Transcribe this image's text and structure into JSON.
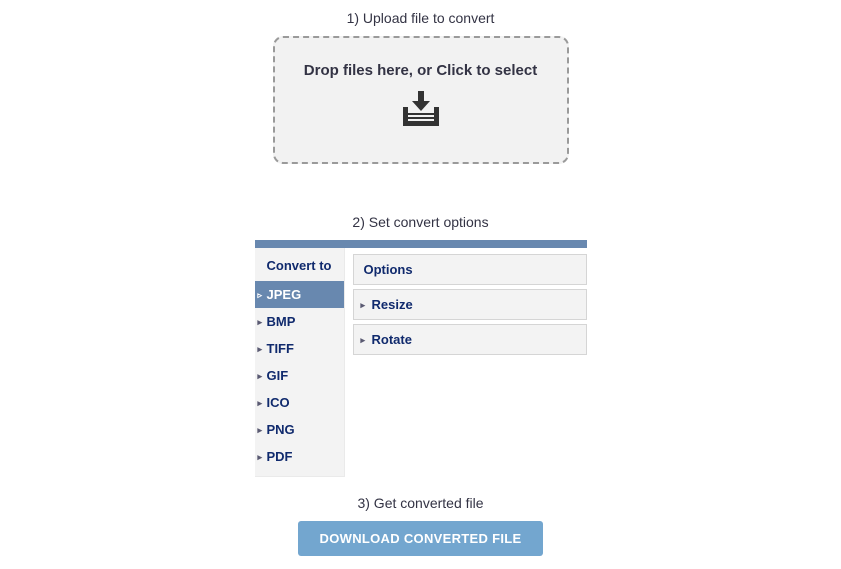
{
  "step1": {
    "title": "1) Upload file to convert",
    "drop_text": "Drop files here, or Click to select"
  },
  "step2": {
    "title": "2) Set convert options",
    "convert_to_label": "Convert to",
    "formats": {
      "jpeg": "JPEG",
      "bmp": "BMP",
      "tiff": "TIFF",
      "gif": "GIF",
      "ico": "ICO",
      "png": "PNG",
      "pdf": "PDF"
    },
    "options": {
      "header": "Options",
      "resize": "Resize",
      "rotate": "Rotate"
    }
  },
  "step3": {
    "title": "3) Get converted file",
    "button": "DOWNLOAD CONVERTED FILE"
  },
  "colors": {
    "accent": "#6888af",
    "link_text": "#102a6d",
    "button_bg": "#73a6cf"
  }
}
